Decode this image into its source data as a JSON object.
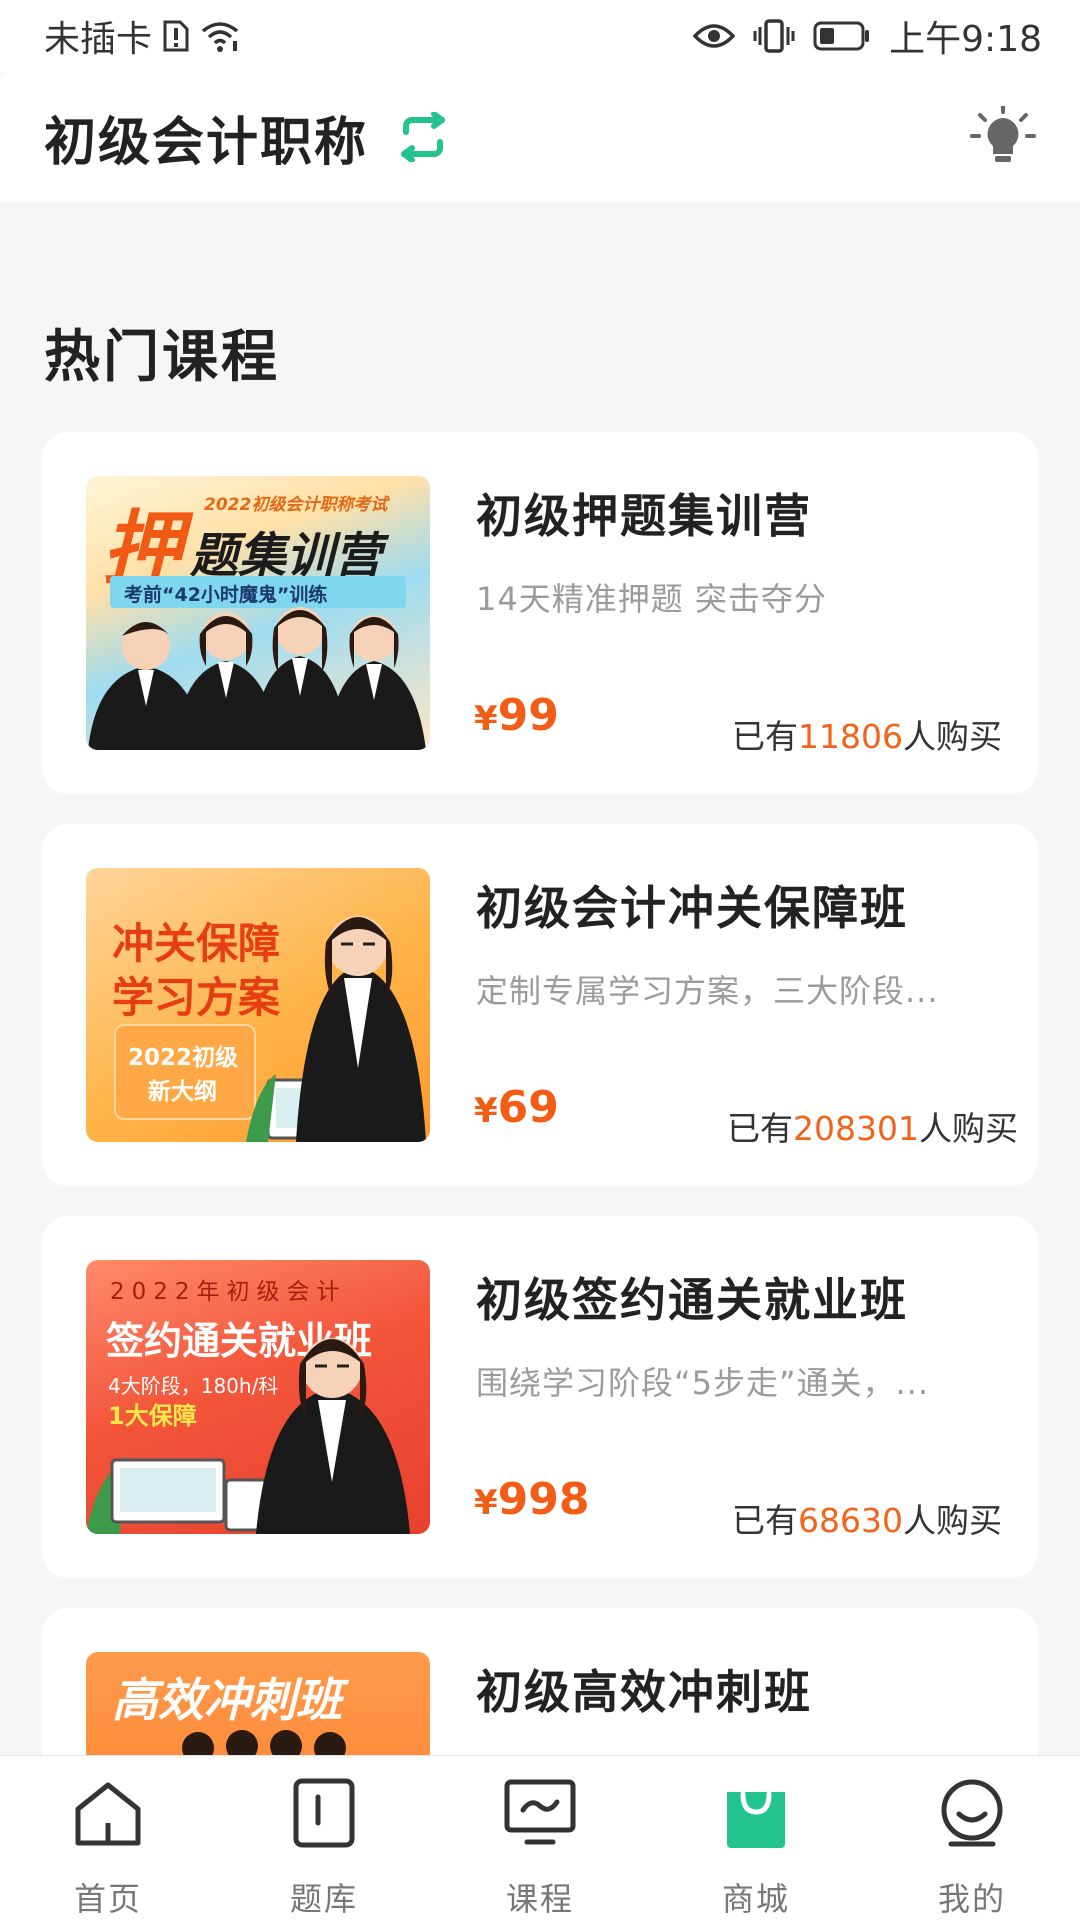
{
  "status_bar": {
    "carrier": "未插卡",
    "time": "上午9:18",
    "icons": [
      "sim-alert-icon",
      "wifi-icon",
      "eye-icon",
      "vibrate-icon",
      "battery-icon"
    ]
  },
  "header": {
    "title": "初级会计职称",
    "switch_icon": "switch-icon",
    "theme_icon": "lightbulb-icon",
    "accent": "#22c38e"
  },
  "section": {
    "title": "热门课程"
  },
  "courses": [
    {
      "title": "初级押题集训营",
      "subtitle": "14天精准押题 突击夺分",
      "currency": "¥",
      "price": "99",
      "sales_prefix": "已有",
      "sales_count": "11806",
      "sales_suffix": "人购买",
      "thumb": {
        "line1": "2022初级会计职称考试",
        "big_char": "押",
        "line2": "题集训营",
        "line3": "考前“42小时魔鬼”训练"
      }
    },
    {
      "title": "初级会计冲关保障班",
      "subtitle": "定制专属学习方案，三大阶段...",
      "currency": "¥",
      "price": "69",
      "sales_prefix": "已有",
      "sales_count": "208301",
      "sales_suffix": "人购买",
      "thumb": {
        "line1": "冲关保障",
        "line2": "学习方案",
        "line3": "2022初级",
        "line4": "新大纲"
      }
    },
    {
      "title": "初级签约通关就业班",
      "subtitle": "围绕学习阶段“5步走”通关，...",
      "currency": "¥",
      "price": "998",
      "sales_prefix": "已有",
      "sales_count": "68630",
      "sales_suffix": "人购买",
      "thumb": {
        "line1": "2022年初级会计",
        "line2": "签约通关就业班",
        "line3": "4大阶段，180h/科",
        "line4": "1大保障"
      }
    },
    {
      "title": "初级高效冲刺班",
      "thumb": {
        "line1": "高效冲刺班"
      }
    }
  ],
  "tabbar": {
    "items": [
      {
        "label": "首页",
        "icon": "home-icon"
      },
      {
        "label": "题库",
        "icon": "question-bank-icon"
      },
      {
        "label": "课程",
        "icon": "course-monitor-icon"
      },
      {
        "label": "商城",
        "icon": "shopping-bag-icon",
        "active": true
      },
      {
        "label": "我的",
        "icon": "profile-icon"
      }
    ]
  },
  "colors": {
    "price": "#f25c14",
    "accent_green": "#22c38e",
    "background": "#f5f6f8"
  }
}
